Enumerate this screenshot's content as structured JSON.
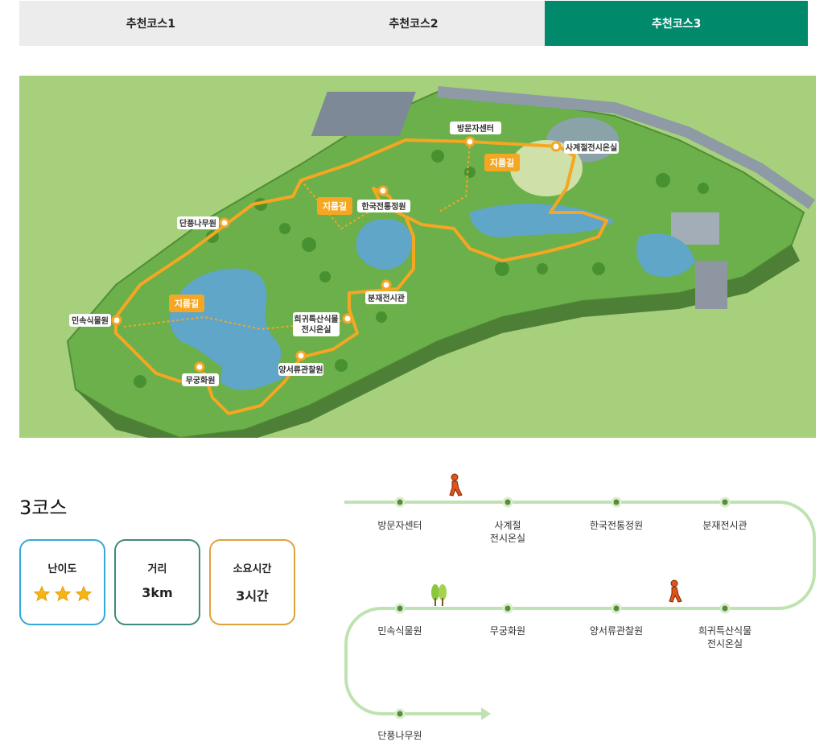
{
  "tabs": [
    {
      "label": "추천코스1",
      "active": false
    },
    {
      "label": "추천코스2",
      "active": false
    },
    {
      "label": "추천코스3",
      "active": true
    }
  ],
  "map": {
    "places": {
      "visitor_center": "방문자센터",
      "seasonal_greenhouse": "사계절전시온실",
      "korean_garden": "한국전통정원",
      "bonsai_hall": "분재전시관",
      "rare_plants": "희귀특산식물\n전시온실",
      "western_garden": "양서류관찰원",
      "rose_garden": "무궁화원",
      "folk_plants": "민속식물원",
      "maple_garden": "단풍나무원"
    },
    "shortcut_label": "지름길",
    "colors": {
      "path": "#f5a623",
      "grass": "#a6d07c",
      "water": "#5fa6c9"
    }
  },
  "course": {
    "title": "3코스",
    "difficulty_label": "난이도",
    "difficulty_stars": 3,
    "distance_label": "거리",
    "distance_value": "3km",
    "time_label": "소요시간",
    "time_value": "3시간"
  },
  "route": {
    "stops": [
      "방문자센터",
      "사계절\n전시온실",
      "한국전통정원",
      "분재전시관",
      "희귀특산식물\n전시온실",
      "양서류관찰원",
      "무궁화원",
      "민속식물원",
      "단풍나무원"
    ],
    "colors": {
      "line": "#bfe3b0",
      "dot": "#5a8a3a",
      "walker": "#e0541a",
      "tree": "#8cc63f"
    }
  }
}
